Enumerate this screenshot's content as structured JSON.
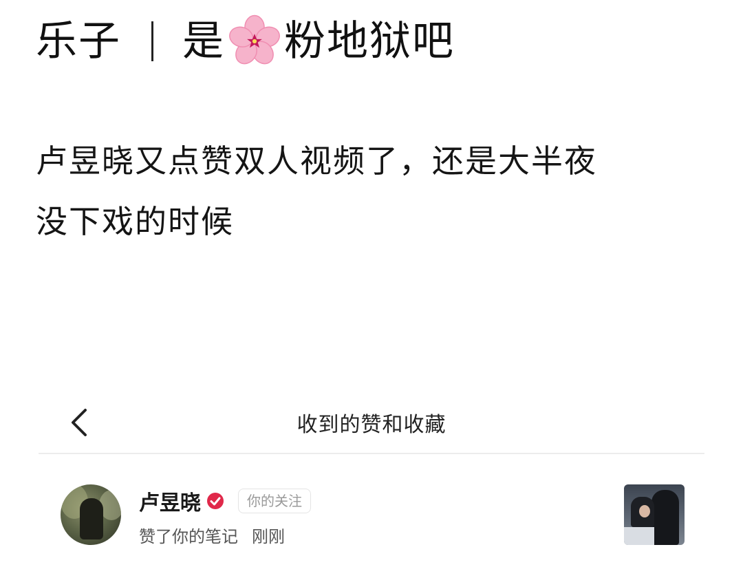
{
  "post": {
    "title_left": "乐子",
    "title_prefix": "是",
    "title_emoji": "cherry-blossom-icon",
    "title_suffix": "粉地狱吧",
    "body_line1": "卢昱晓又点赞双人视频了，还是大半夜",
    "body_line2": "没下戏的时候"
  },
  "embed": {
    "back_icon": "chevron-left-icon",
    "header_title": "收到的赞和收藏",
    "notification": {
      "username": "卢昱晓",
      "verified_icon": "verified-badge-icon",
      "relation_badge": "你的关注",
      "action": "赞了你的笔记",
      "time": "刚刚"
    }
  },
  "colors": {
    "verified_red": "#e0284a",
    "blossom_pink": "#f6a8c4",
    "blossom_center": "#c2185b"
  }
}
